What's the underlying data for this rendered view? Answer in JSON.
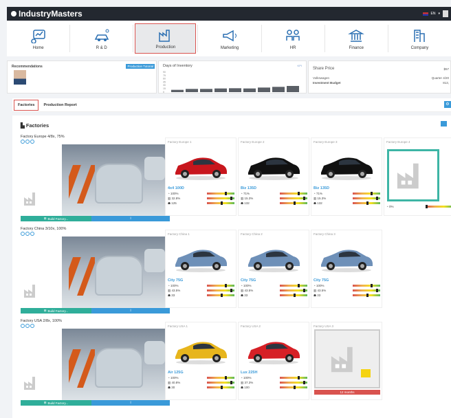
{
  "topbar": {
    "logo": "IndustryMasters",
    "lang": "EN"
  },
  "nav": [
    {
      "label": "Home",
      "icon": "home-chart-icon"
    },
    {
      "label": "R & D",
      "icon": "car-idea-icon"
    },
    {
      "label": "Production",
      "icon": "factory-icon",
      "active": true
    },
    {
      "label": "Marketing",
      "icon": "megaphone-icon"
    },
    {
      "label": "HR",
      "icon": "people-icon"
    },
    {
      "label": "Finance",
      "icon": "bank-icon"
    },
    {
      "label": "Company",
      "icon": "building-icon"
    }
  ],
  "summary": {
    "recommendations": {
      "title": "Recommendations",
      "tutorial": "Production Tutorial"
    },
    "inventory": {
      "title": "Days of Inventory",
      "control": "KPI",
      "yticks": [
        "90",
        "75",
        "60",
        "45",
        "30",
        "15",
        "0"
      ],
      "bars": [
        10,
        14,
        14,
        16,
        17,
        16,
        20,
        23,
        27
      ]
    },
    "share": {
      "title": "Share Price",
      "value": "$57",
      "company": "Volkswagen",
      "budget": "Investment Budget",
      "quarter": "Quarter 4/20",
      "budget_value": "813,"
    }
  },
  "tabs": [
    {
      "label": "Factories",
      "active": true
    },
    {
      "label": "Production Report"
    }
  ],
  "main": {
    "title": "Factories",
    "build_label": "Build Factory...",
    "info_label": "i",
    "rows": [
      {
        "city": "Factory Europe 4/8x, 75%",
        "slots": [
          {
            "name": "Factory Europe 1",
            "model": "4x4 100D",
            "s1": "100%",
            "s2": "32.8%",
            "s3": "125",
            "car": "#c8161d"
          },
          {
            "name": "Factory Europe 2",
            "model": "Biz 135D",
            "s1": "71%",
            "s2": "15.3%",
            "s3": "132",
            "car": "#111"
          },
          {
            "name": "Factory Europe 3",
            "model": "Biz 135D",
            "s1": "71%",
            "s2": "15.3%",
            "s3": "132",
            "car": "#111"
          },
          {
            "name": "Factory Europe 4",
            "empty": true,
            "s1": "0%"
          }
        ]
      },
      {
        "city": "Factory China 3/10x, 100%",
        "slots": [
          {
            "name": "Factory China 1",
            "model": "City 75G",
            "s1": "100%",
            "s2": "43.5%",
            "s3": "33",
            "car": "#6e90b8"
          },
          {
            "name": "Factory China 2",
            "model": "City 75G",
            "s1": "100%",
            "s2": "43.5%",
            "s3": "33",
            "car": "#6e90b8"
          },
          {
            "name": "Factory China 3",
            "model": "City 75G",
            "s1": "100%",
            "s2": "43.5%",
            "s3": "33",
            "car": "#6e90b8"
          }
        ]
      },
      {
        "city": "Factory USA 2/8x, 100%",
        "slots": [
          {
            "name": "Factory USA 1",
            "model": "Air 125G",
            "s1": "100%",
            "s2": "40.8%",
            "s3": "30",
            "car": "#e7b51c"
          },
          {
            "name": "Factory USA 2",
            "model": "Lux 225H",
            "s1": "100%",
            "s2": "37.3%",
            "s3": "100",
            "car": "#d62026"
          },
          {
            "name": "Factory USA 3",
            "construction": true,
            "months": "12 months"
          }
        ]
      }
    ]
  }
}
